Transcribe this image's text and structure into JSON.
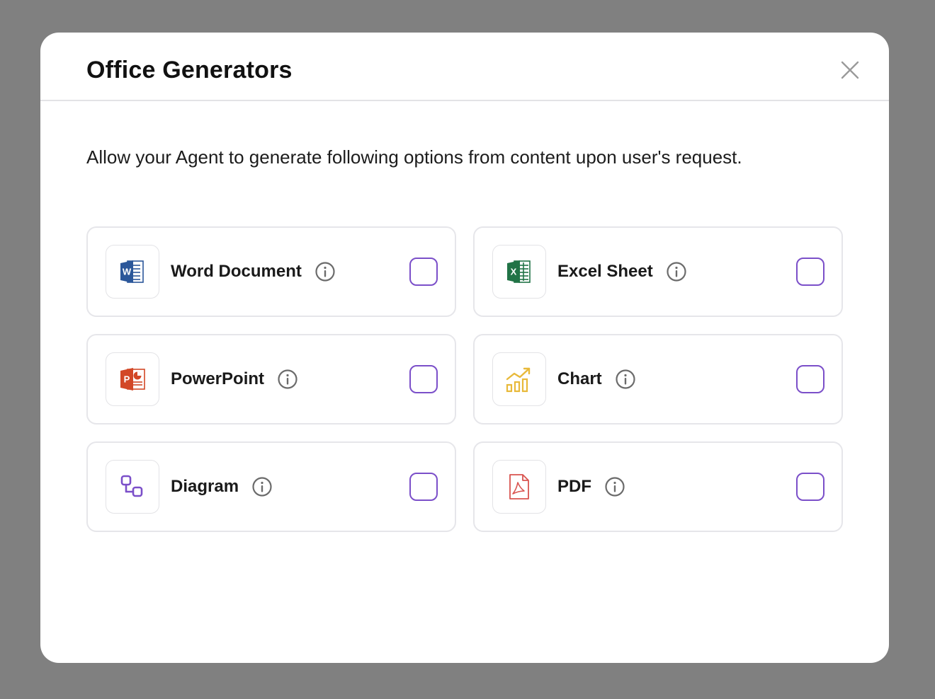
{
  "modal": {
    "title": "Office Generators",
    "description": "Allow your Agent to generate following options from content upon user's request.",
    "close_icon": "close-icon"
  },
  "options": [
    {
      "label": "Word Document",
      "icon": "word-document-icon",
      "checked": false
    },
    {
      "label": "Excel Sheet",
      "icon": "excel-sheet-icon",
      "checked": false
    },
    {
      "label": "PowerPoint",
      "icon": "powerpoint-icon",
      "checked": false
    },
    {
      "label": "Chart",
      "icon": "chart-icon",
      "checked": false
    },
    {
      "label": "Diagram",
      "icon": "diagram-icon",
      "checked": false
    },
    {
      "label": "PDF",
      "icon": "pdf-icon",
      "checked": false
    }
  ],
  "colors": {
    "checkbox_border": "#7b4fc9",
    "word_blue": "#2b579a",
    "excel_green": "#217346",
    "powerpoint_red": "#d24726",
    "chart_yellow": "#e8b93a",
    "diagram_purple": "#7b4fc9",
    "pdf_red": "#d9534f"
  }
}
